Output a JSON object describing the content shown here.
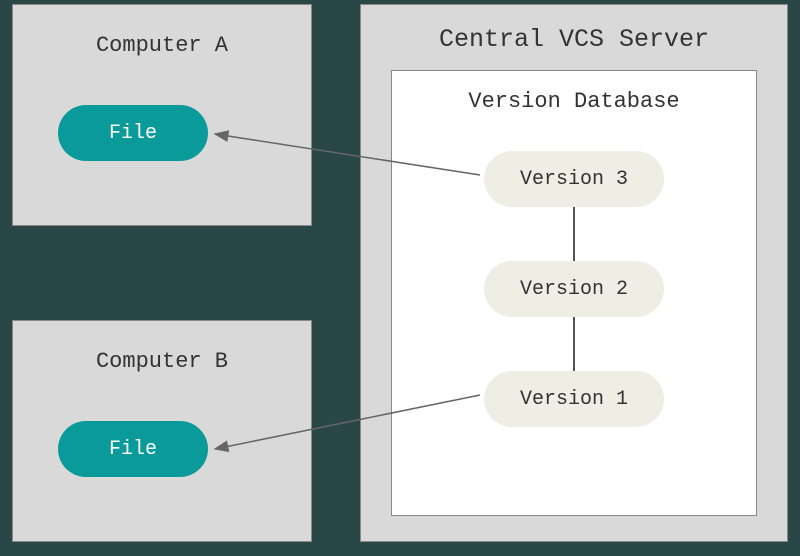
{
  "computer_a": {
    "title": "Computer A",
    "file_label": "File"
  },
  "computer_b": {
    "title": "Computer B",
    "file_label": "File"
  },
  "server": {
    "title": "Central VCS Server",
    "database": {
      "title": "Version Database",
      "versions": [
        "Version 3",
        "Version 2",
        "Version 1"
      ]
    }
  },
  "colors": {
    "panel_bg": "#d9d9d9",
    "file_pill": "#0b9a9a",
    "version_pill": "#eeeee4",
    "page_bg": "#2a4747"
  }
}
